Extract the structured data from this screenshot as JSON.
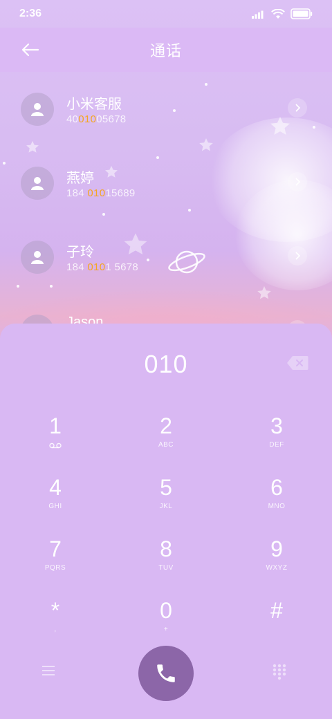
{
  "status_bar": {
    "time": "2:36",
    "icons": [
      "signal-icon",
      "wifi-icon",
      "battery-icon"
    ]
  },
  "header": {
    "title": "通话",
    "back_icon": "arrow-left-icon"
  },
  "contacts": [
    {
      "name": "小米客服",
      "number_pre": "40",
      "number_match": "010",
      "number_post": "05678"
    },
    {
      "name": "燕婷",
      "number_pre": "184 ",
      "number_match": "010",
      "number_post": "15689"
    },
    {
      "name": "子玲",
      "number_pre": "184 ",
      "number_match": "010",
      "number_post": "1 5678"
    },
    {
      "name": "Jason",
      "number_pre": "",
      "number_match": "",
      "number_post": ""
    }
  ],
  "dialpad": {
    "input_value": "010",
    "keys": [
      {
        "digit": "1",
        "letters": ""
      },
      {
        "digit": "2",
        "letters": "ABC"
      },
      {
        "digit": "3",
        "letters": "DEF"
      },
      {
        "digit": "4",
        "letters": "GHI"
      },
      {
        "digit": "5",
        "letters": "JKL"
      },
      {
        "digit": "6",
        "letters": "MNO"
      },
      {
        "digit": "7",
        "letters": "PQRS"
      },
      {
        "digit": "8",
        "letters": "TUV"
      },
      {
        "digit": "9",
        "letters": "WXYZ"
      },
      {
        "digit": "*",
        "letters": ","
      },
      {
        "digit": "0",
        "letters": "+"
      },
      {
        "digit": "#",
        "letters": ""
      }
    ]
  },
  "colors": {
    "background": "#d9b8f3",
    "call_button": "#8c66a8",
    "match_highlight": "#f5a623"
  }
}
